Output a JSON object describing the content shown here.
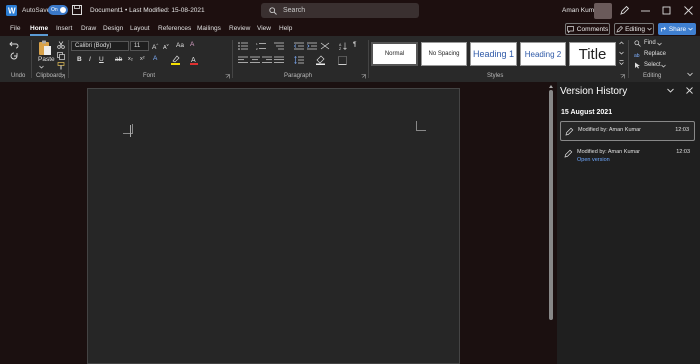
{
  "titlebar": {
    "autosave_label": "AutoSave",
    "autosave_state": "On",
    "document_title": "Document1 • Last Modified: 15-08-2021",
    "search_placeholder": "Search",
    "user_name": "Aman Kumar"
  },
  "menu": {
    "items": [
      "File",
      "Home",
      "Insert",
      "Draw",
      "Design",
      "Layout",
      "References",
      "Mailings",
      "Review",
      "View",
      "Help"
    ],
    "active": "Home",
    "comments_label": "Comments",
    "editing_label": "Editing",
    "share_label": "Share"
  },
  "ribbon": {
    "groups": {
      "undo": "Undo",
      "clipboard": "Clipboard",
      "font": "Font",
      "paragraph": "Paragraph",
      "styles": "Styles",
      "editing": "Editing"
    },
    "paste_label": "Paste",
    "font_name": "Calibri (Body)",
    "font_size": "11",
    "styles": [
      "Normal",
      "No Spacing",
      "Heading 1",
      "Heading 2",
      "Title"
    ],
    "find_label": "Find",
    "replace_label": "Replace",
    "select_label": "Select"
  },
  "version_history": {
    "title": "Version History",
    "date": "15 August 2021",
    "versions": [
      {
        "text": "Modified by: Aman Kumar",
        "time": "12:03",
        "link": ""
      },
      {
        "text": "Modified by: Aman Kumar",
        "time": "12:03",
        "link": "Open version"
      }
    ]
  },
  "colors": {
    "accent": "#3f7fd0",
    "titlebar_bg": "#1d0f0f",
    "ribbon_bg": "#292929",
    "page_bg": "#262626",
    "link": "#6ea8ff"
  }
}
